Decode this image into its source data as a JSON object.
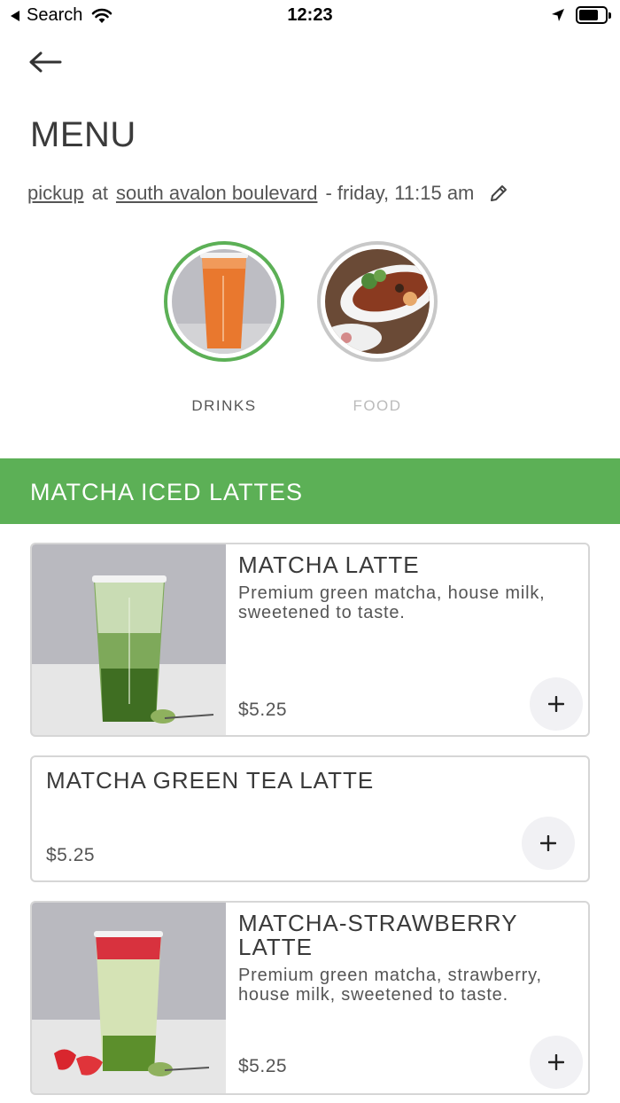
{
  "status_bar": {
    "back_app": "Search",
    "time": "12:23",
    "battery_level": 0.75
  },
  "header": {
    "title": "MENU"
  },
  "order": {
    "mode": "pickup",
    "at": "at",
    "location": "south avalon boulevard",
    "time": "- friday, 11:15 am"
  },
  "categories": [
    {
      "label": "DRINKS",
      "active": true
    },
    {
      "label": "FOOD",
      "active": false
    }
  ],
  "section": {
    "title": "MATCHA ICED LATTES"
  },
  "items": [
    {
      "name": "MATCHA LATTE",
      "description": "Premium green matcha, house milk, sweetened to taste.",
      "price": "$5.25"
    },
    {
      "name": "MATCHA GREEN TEA LATTE",
      "price": "$5.25"
    },
    {
      "name": "MATCHA-STRAWBERRY LATTE",
      "description": "Premium green matcha, strawberry, house milk, sweetened to taste.",
      "price": "$5.25"
    }
  ],
  "icons": {
    "back": "arrow-left-icon",
    "edit": "pencil-icon",
    "add": "plus-icon"
  },
  "colors": {
    "accent": "#5cb056",
    "inactive_ring": "#c8c8c8",
    "add_button_bg": "#f1f1f4"
  }
}
